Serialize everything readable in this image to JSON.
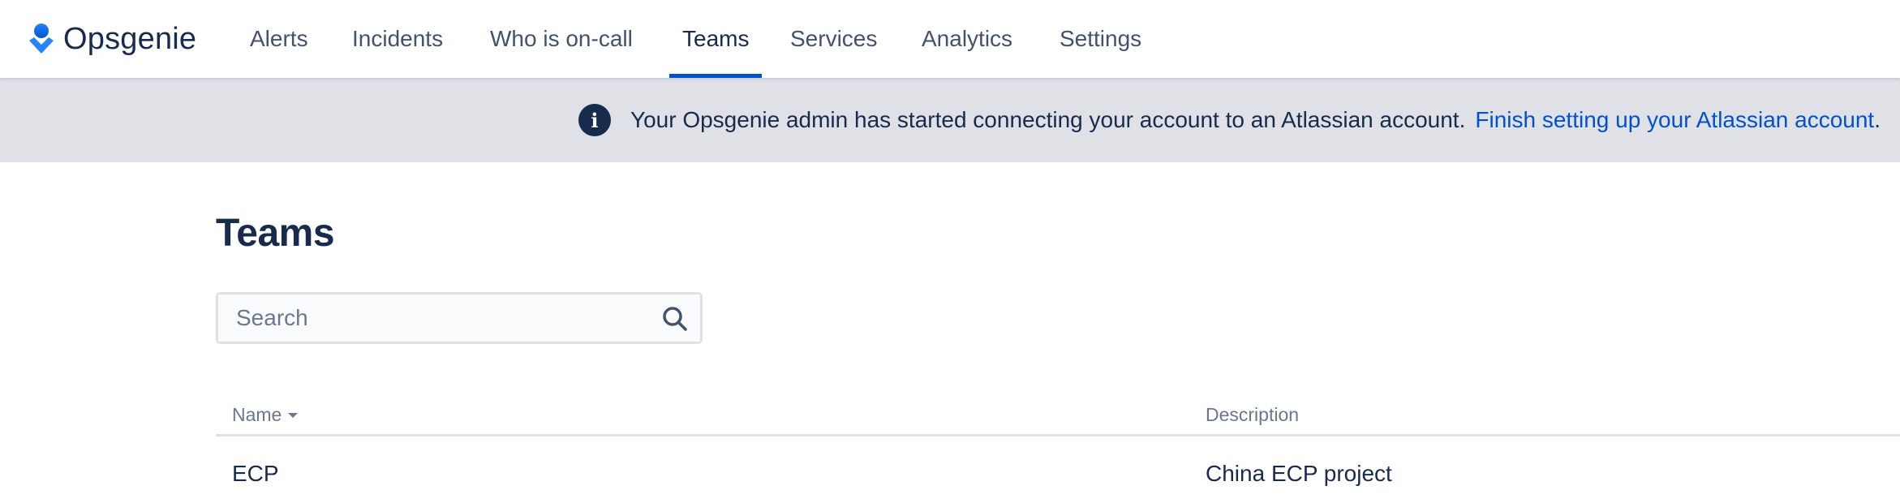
{
  "app": {
    "name": "Opsgenie",
    "brand_color": "#2684ff",
    "logo_icon": "opsgenie-logo-icon"
  },
  "nav": {
    "items": [
      {
        "label": "Alerts",
        "active": false
      },
      {
        "label": "Incidents",
        "active": false
      },
      {
        "label": "Who is on-call",
        "active": false
      },
      {
        "label": "Teams",
        "active": true
      },
      {
        "label": "Services",
        "active": false
      },
      {
        "label": "Analytics",
        "active": false
      },
      {
        "label": "Settings",
        "active": false
      }
    ],
    "active_indicator_color": "#0052cc"
  },
  "banner": {
    "icon": "info-icon",
    "icon_glyph": "i",
    "message": "Your Opsgenie admin has started connecting your account to an Atlassian account.",
    "link_text": "Finish setting up your Atlassian account",
    "trailing": ".",
    "background": "#dfe1e6",
    "link_color": "#0052cc"
  },
  "page": {
    "title": "Teams",
    "search": {
      "placeholder": "Search",
      "value": "",
      "icon": "search-icon"
    }
  },
  "table": {
    "columns": [
      {
        "label": "Name",
        "sortable": true,
        "sort": "descending"
      },
      {
        "label": "Description",
        "sortable": false
      }
    ],
    "rows": [
      {
        "name": "ECP",
        "description": "China ECP project"
      }
    ]
  }
}
